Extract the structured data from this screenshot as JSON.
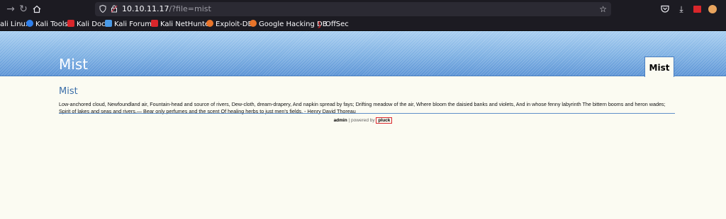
{
  "browser": {
    "url_host": "10.10.11.17",
    "url_path": "/?file=mist",
    "bookmarks": [
      {
        "label": "ali Linux",
        "icon": "kali-icon",
        "color": "#3a7bd5"
      },
      {
        "label": "Kali Tools",
        "icon": "kali-icon",
        "color": "#2f80ed"
      },
      {
        "label": "Kali Docs",
        "icon": "docs-icon",
        "color": "#d9262b"
      },
      {
        "label": "Kali Forums",
        "icon": "forums-icon",
        "color": "#4a9ae8"
      },
      {
        "label": "Kali NetHunter",
        "icon": "nethunter-icon",
        "color": "#d9262b"
      },
      {
        "label": "Exploit-DB",
        "icon": "exploitdb-icon",
        "color": "#e8742a"
      },
      {
        "label": "Google Hacking DB",
        "icon": "ghdb-icon",
        "color": "#e8742a"
      },
      {
        "label": "OffSec",
        "icon": "offsec-icon",
        "color": "#d9262b"
      }
    ]
  },
  "site": {
    "title": "Mist",
    "nav_tab": "Mist"
  },
  "content": {
    "heading": "Mist",
    "body": "Low-anchored cloud, Newfoundland air, Fountain-head and source of rivers, Dew-cloth, dream-drapery, And napkin spread by fays; Drifting meadow of the air, Where bloom the daisied banks and violets, And in whose fenny labyrinth The bittern booms and heron wades; Spirit of lakes and seas and rivers,— Bear only perfumes and the scent Of healing herbs to just men's fields. - Henry David Thoreau"
  },
  "footer": {
    "admin": "admin",
    "separator": " | powered by ",
    "pluck": "pluck"
  },
  "colors": {
    "header_blue": "#7fb1e3",
    "heading_blue": "#3b6ea8",
    "highlight_red": "#d9262b"
  }
}
